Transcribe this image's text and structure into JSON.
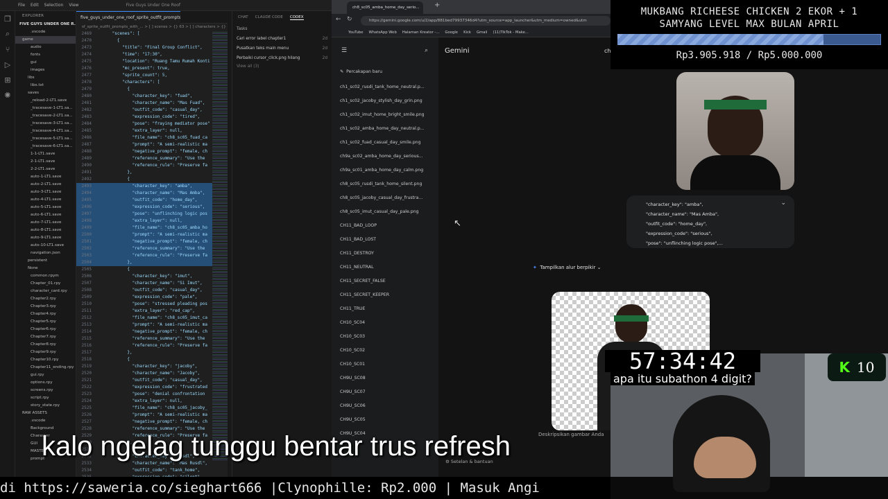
{
  "vscode": {
    "window_title": "Five Guys Under One Roof",
    "menu": [
      "File",
      "Edit",
      "Selection",
      "View"
    ],
    "tab_label": "five_guys_under_one_roof_sprite_outfit_prompts",
    "breadcrumb": "sf_sprite_outfit_prompts_with_... > [ ] scenes > {} 63 > [ ] characters > {} 1",
    "explorer_title": "EXPLORER",
    "project": "FIVE GUYS UNDER ONE R...",
    "tree": [
      ".vscode",
      "game",
      "audio",
      "fonts",
      "gui",
      "images",
      "libs",
      "libs.txt",
      "saves",
      "_reload-2-LT1.save",
      "_tracesave-1-LT1.sa...",
      "_tracesave-2-LT1.sa...",
      "_tracesave-3-LT1.sa...",
      "_tracesave-4-LT1.sa...",
      "_tracesave-5-LT1.sa...",
      "_tracesave-6-LT1.sa...",
      "1-1-LT1.save",
      "2-1-LT1.save",
      "2-2-LT1.save",
      "auto-1-LT1.save",
      "auto-2-LT1.save",
      "auto-3-LT1.save",
      "auto-4-LT1.save",
      "auto-5-LT1.save",
      "auto-6-LT1.save",
      "auto-7-LT1.save",
      "auto-8-LT1.save",
      "auto-9-LT1.save",
      "auto-10-LT1.save",
      "navigation.json",
      "persistent",
      "None",
      "common.rpym",
      "Chapter_01.rpy",
      "character_card.rpy",
      "Chapter2.rpy",
      "Chapter3.rpy",
      "Chapter4.rpy",
      "Chapter5.rpy",
      "Chapter6.rpy",
      "Chapter7.rpy",
      "Chapter8.rpy",
      "Chapter9.rpy",
      "Chapter10.rpy",
      "Chapter11_ending.rpy",
      "gui.rpy",
      "options.rpy",
      "screens.rpy",
      "script.rpy",
      "story_state.rpy",
      "RAW ASSETS",
      ".vscode",
      "Background",
      "Character",
      "GUI",
      "MASTER",
      "prompt"
    ],
    "code": [
      {
        "n": "2469",
        "t": "      \"scenes\": ["
      },
      {
        "n": "2470",
        "t": "        {"
      },
      {
        "n": "2473",
        "t": "          \"title\": \"Final Group Conflict\","
      },
      {
        "n": "2474",
        "t": "          \"time\": \"17:30\","
      },
      {
        "n": "2475",
        "t": "          \"location\": \"Ruang Tamu Rumah Konti"
      },
      {
        "n": "2476",
        "t": "          \"mc_present\": true,"
      },
      {
        "n": "2477",
        "t": "          \"sprite_count\": 5,"
      },
      {
        "n": "2478",
        "t": "          \"characters\": ["
      },
      {
        "n": "2479",
        "t": "            {"
      },
      {
        "n": "2480",
        "t": "              \"character_key\": \"fuad\","
      },
      {
        "n": "2481",
        "t": "              \"character_name\": \"Mas Fuad\","
      },
      {
        "n": "2482",
        "t": "              \"outfit_code\": \"casual_day\","
      },
      {
        "n": "2483",
        "t": "              \"expression_code\": \"tired\","
      },
      {
        "n": "2484",
        "t": "              \"pose\": \"fraying mediator pose\""
      },
      {
        "n": "2485",
        "t": "              \"extra_layer\": null,"
      },
      {
        "n": "2486",
        "t": "              \"file_name\": \"ch8_sc05_fuad_ca"
      },
      {
        "n": "2487",
        "t": "              \"prompt\": \"A semi-realistic ma"
      },
      {
        "n": "2488",
        "t": "              \"negative_prompt\": \"female, ch"
      },
      {
        "n": "2489",
        "t": "              \"reference_summary\": \"Use the"
      },
      {
        "n": "2490",
        "t": "              \"reference_rule\": \"Preserve fa"
      },
      {
        "n": "2491",
        "t": "            },"
      },
      {
        "n": "2492",
        "t": "            {"
      },
      {
        "n": "2493",
        "t": "              \"character_key\": \"amba\","
      },
      {
        "n": "2494",
        "t": "              \"character_name\": \"Mas Amba\","
      },
      {
        "n": "2495",
        "t": "              \"outfit_code\": \"home_day\","
      },
      {
        "n": "2496",
        "t": "              \"expression_code\": \"serious\","
      },
      {
        "n": "2497",
        "t": "              \"pose\": \"unflinching logic pos"
      },
      {
        "n": "2498",
        "t": "              \"extra_layer\": null,"
      },
      {
        "n": "2499",
        "t": "              \"file_name\": \"ch8_sc05_amba_ho"
      },
      {
        "n": "2500",
        "t": "              \"prompt\": \"A semi-realistic ma"
      },
      {
        "n": "2501",
        "t": "              \"negative_prompt\": \"female, ch"
      },
      {
        "n": "2502",
        "t": "              \"reference_summary\": \"Use the"
      },
      {
        "n": "2503",
        "t": "              \"reference_rule\": \"Preserve fa"
      },
      {
        "n": "2504",
        "t": "            },"
      },
      {
        "n": "2505",
        "t": "            {"
      },
      {
        "n": "2506",
        "t": "              \"character_key\": \"imut\","
      },
      {
        "n": "2507",
        "t": "              \"character_name\": \"Si Imut\","
      },
      {
        "n": "2508",
        "t": "              \"outfit_code\": \"casual_day\","
      },
      {
        "n": "2509",
        "t": "              \"expression_code\": \"pale\","
      },
      {
        "n": "2510",
        "t": "              \"pose\": \"stressed pleading pos"
      },
      {
        "n": "2511",
        "t": "              \"extra_layer\": \"red_cap\","
      },
      {
        "n": "2512",
        "t": "              \"file_name\": \"ch8_sc05_imut_ca"
      },
      {
        "n": "2513",
        "t": "              \"prompt\": \"A semi-realistic ma"
      },
      {
        "n": "2514",
        "t": "              \"negative_prompt\": \"female, ch"
      },
      {
        "n": "2515",
        "t": "              \"reference_summary\": \"Use the"
      },
      {
        "n": "2516",
        "t": "              \"reference_rule\": \"Preserve fa"
      },
      {
        "n": "2517",
        "t": "            },"
      },
      {
        "n": "2518",
        "t": "            {"
      },
      {
        "n": "2519",
        "t": "              \"character_key\": \"jacoby\","
      },
      {
        "n": "2520",
        "t": "              \"character_name\": \"Jacoby\","
      },
      {
        "n": "2521",
        "t": "              \"outfit_code\": \"casual_day\","
      },
      {
        "n": "2522",
        "t": "              \"expression_code\": \"frustrated"
      },
      {
        "n": "2523",
        "t": "              \"pose\": \"denial confrontation"
      },
      {
        "n": "2524",
        "t": "              \"extra_layer\": null,"
      },
      {
        "n": "2525",
        "t": "              \"file_name\": \"ch8_sc05_jacoby_"
      },
      {
        "n": "2526",
        "t": "              \"prompt\": \"A semi-realistic ma"
      },
      {
        "n": "2527",
        "t": "              \"negative_prompt\": \"female, ch"
      },
      {
        "n": "2528",
        "t": "              \"reference_summary\": \"Use the"
      },
      {
        "n": "2529",
        "t": "              \"reference_rule\": \"Preserve fa"
      },
      {
        "n": "2530",
        "t": "            },"
      },
      {
        "n": "2531",
        "t": "            {"
      },
      {
        "n": "2532",
        "t": "              \"character_key\": \"rusdl\","
      },
      {
        "n": "2533",
        "t": "              \"character_name\": \"Mas Rusdl\","
      },
      {
        "n": "2534",
        "t": "              \"outfit_code\": \"tank_home\","
      },
      {
        "n": "2535",
        "t": "              \"expression_code\": \"silent\","
      },
      {
        "n": "2536",
        "t": "              \"pose\": \"watchful pose\","
      }
    ],
    "chat_tabs": [
      "CHAT",
      "CLAUDE CODE",
      "CODEX"
    ],
    "tasks_title": "Tasks",
    "tasks": [
      {
        "label": "Cari error label chapter1",
        "age": "2d"
      },
      {
        "label": "Pusatkan teks main menu",
        "age": "2d"
      },
      {
        "label": "Perbaiki cursor_click.png hilang",
        "age": "2d"
      }
    ],
    "view_all": "View all (3)"
  },
  "chrome": {
    "tab_title": "ch8_sc05_amba_home_day_serio...",
    "url": "https://gemini.google.com/u/2/app/881bed79937346d4?utm_source=app_launcher&utm_medium=owned&utm",
    "bookmarks": [
      "YouTube",
      "WhatsApp Web",
      "Halaman Kreator -...",
      "Google",
      "Kick",
      "Gmail",
      "(11)TikTok - Make..."
    ],
    "gemini_title": "Gemini",
    "new_chat": "Percakapan baru",
    "chats": [
      "ch1_sc02_rusdi_tank_home_neutral.p...",
      "ch1_sc02_jacoby_stylish_day_grin.png",
      "ch1_sc02_imut_home_bright_smile.png",
      "ch1_sc02_amba_home_day_neutral.p...",
      "ch1_sc02_fuad_casual_day_smile.png",
      "ch9a_sc02_amba_home_day_serious...",
      "ch9a_sc01_amba_home_day_calm.png",
      "ch8_sc05_rusdi_tank_home_silent.png",
      "ch8_sc05_jacoby_casual_day_frustra...",
      "ch8_sc05_imut_casual_day_pale.png",
      "CH11_BAD_LOOP",
      "CH11_BAD_LOST",
      "CH11_DESTROY",
      "CH11_NEUTRAL",
      "CH11_SECRET_FALSE",
      "CH11_SECRET_KEEPER",
      "CH11_TRUE",
      "CH10_SC04",
      "CH10_SC03",
      "CH10_SC02",
      "CH10_SC01",
      "CH9U_SC08",
      "CH9U_SC07",
      "CH9U_SC06",
      "CH9U_SC05",
      "CH9U_SC04"
    ],
    "thinking_label": "Tampilkan alur berpikir",
    "prompt_lines": [
      "\"character_key\": \"amba\",",
      "\"character_name\": \"Mas Amba\",",
      "\"outfit_code\": \"home_day\",",
      "\"expression_code\": \"serious\",",
      "\"pose\": \"unflinching logic pose\",..."
    ],
    "input_placeholder": "Deskripsikan gambar Anda",
    "settings_label": "Setelan & bantuan",
    "header_initial": "ch"
  },
  "stream": {
    "goal_title_1": "MUKBANG RICHEESE CHICKEN 2 EKOR + 1",
    "goal_title_2": "SAMYANG LEVEL MAX BULAN APRIL",
    "goal_progress": 0.781,
    "goal_amount": "Rp3.905.918 / Rp5.000.000",
    "timer": "57:34:42",
    "timer_question": "apa itu subathon 4 digit?",
    "kick_count": "10",
    "kick_logo": "K",
    "subtitle": "kalo ngelag tunggu bentar trus refresh",
    "ticker": "di https://saweria.co/sieghart666 |Clynophille: Rp2.000 | Masuk Angi",
    "colors": {
      "goal_bar": "#3a5a90",
      "kick_green": "#53fc18",
      "bg": "#000000"
    }
  }
}
